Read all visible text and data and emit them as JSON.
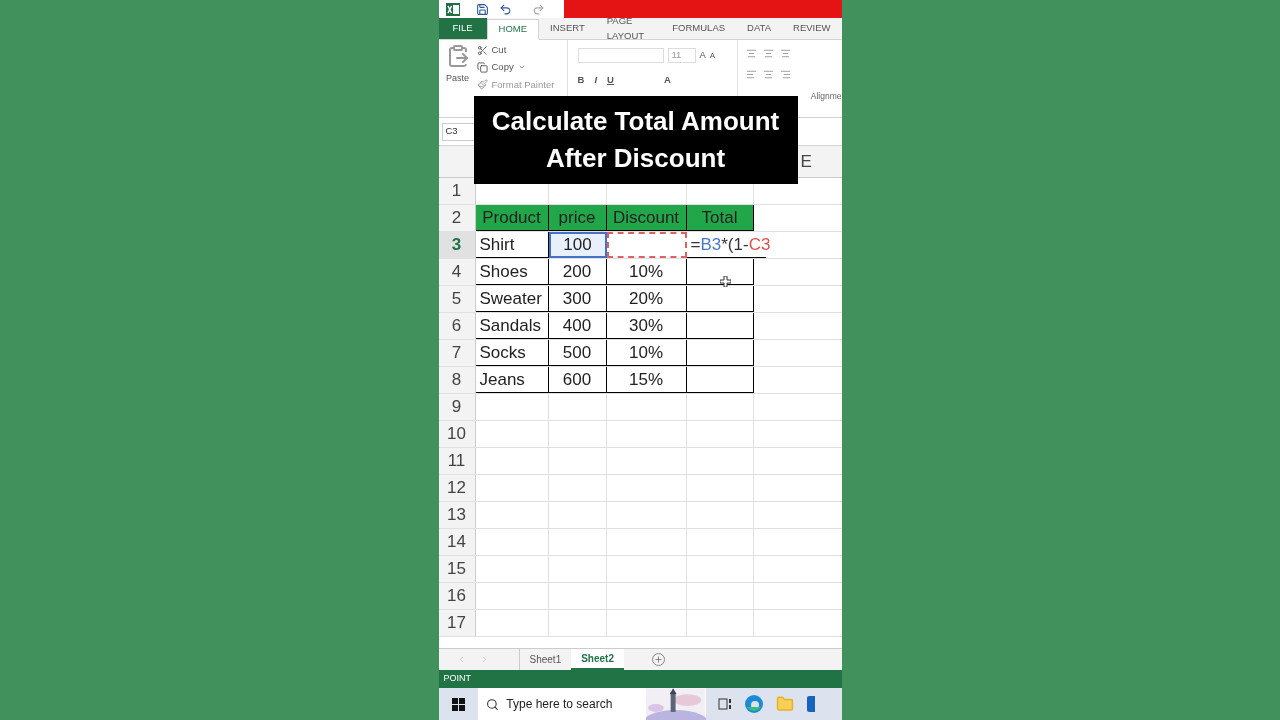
{
  "ribbon": {
    "tabs": [
      {
        "label": "FILE",
        "kind": "file",
        "selected": false
      },
      {
        "label": "HOME",
        "kind": "tab",
        "selected": true
      },
      {
        "label": "INSERT",
        "kind": "tab",
        "selected": false
      },
      {
        "label": "PAGE LAYOUT",
        "kind": "tab",
        "selected": false
      },
      {
        "label": "FORMULAS",
        "kind": "tab",
        "selected": false
      },
      {
        "label": "DATA",
        "kind": "tab",
        "selected": false
      },
      {
        "label": "REVIEW",
        "kind": "tab",
        "selected": false
      }
    ],
    "clipboard": {
      "paste": "Paste",
      "cut": "Cut",
      "copy": "Copy",
      "format_painter": "Format Painter"
    },
    "font": {
      "size": "11",
      "bold": "B",
      "italic": "I",
      "underline": "U",
      "grow": "A",
      "shrink": "A",
      "font_color": "A"
    },
    "group_label": "Alignme"
  },
  "name_box": "C3",
  "caption": [
    "Calculate Total Amount",
    "After Discount"
  ],
  "column_header": "E",
  "rows": [
    {
      "number": "1",
      "active": false
    },
    {
      "number": "2",
      "active": false,
      "cells": [
        {
          "text": "Product",
          "kind": "header"
        },
        {
          "text": "price",
          "kind": "header"
        },
        {
          "text": "Discount",
          "kind": "header"
        },
        {
          "text": "Total",
          "kind": "header"
        }
      ]
    },
    {
      "number": "3",
      "active": true,
      "cells": [
        {
          "text": "Shirt",
          "kind": "text"
        },
        {
          "text": "100",
          "kind": "number",
          "color": "#4472c4"
        },
        {
          "kind": "empty",
          "color": "#e06060"
        },
        {
          "kind": "formula",
          "formula_parts": [
            {
              "text": "=",
              "color": "#333333"
            },
            {
              "text": "B3",
              "color": "#4a78c8"
            },
            {
              "text": "*(1-",
              "color": "#333333"
            },
            {
              "text": "C3",
              "color": "#d9534f"
            }
          ]
        }
      ]
    },
    {
      "number": "4",
      "active": false,
      "cells": [
        {
          "text": "Shoes",
          "kind": "text"
        },
        {
          "text": "200",
          "kind": "number"
        },
        {
          "text": "10%",
          "kind": "number"
        },
        {
          "kind": "empty"
        }
      ]
    },
    {
      "number": "5",
      "active": false,
      "cells": [
        {
          "text": "Sweater",
          "kind": "text"
        },
        {
          "text": "300",
          "kind": "number"
        },
        {
          "text": "20%",
          "kind": "number"
        },
        {
          "kind": "empty"
        }
      ]
    },
    {
      "number": "6",
      "active": false,
      "cells": [
        {
          "text": "Sandals",
          "kind": "text"
        },
        {
          "text": "400",
          "kind": "number"
        },
        {
          "text": "30%",
          "kind": "number"
        },
        {
          "kind": "empty"
        }
      ]
    },
    {
      "number": "7",
      "active": false,
      "cells": [
        {
          "text": "Socks",
          "kind": "text"
        },
        {
          "text": "500",
          "kind": "number"
        },
        {
          "text": "10%",
          "kind": "number"
        },
        {
          "kind": "empty"
        }
      ]
    },
    {
      "number": "8",
      "active": false,
      "cells": [
        {
          "text": "Jeans",
          "kind": "text"
        },
        {
          "text": "600",
          "kind": "number"
        },
        {
          "text": "15%",
          "kind": "number"
        },
        {
          "kind": "empty"
        }
      ]
    },
    {
      "number": "9",
      "active": false
    },
    {
      "number": "10",
      "active": false
    },
    {
      "number": "11",
      "active": false
    },
    {
      "number": "12",
      "active": false
    },
    {
      "number": "13",
      "active": false
    },
    {
      "number": "14",
      "active": false
    },
    {
      "number": "15",
      "active": false
    },
    {
      "number": "16",
      "active": false
    },
    {
      "number": "17",
      "active": false
    }
  ],
  "sheet_tabs": [
    {
      "label": "Sheet1",
      "selected": false
    },
    {
      "label": "Sheet2",
      "selected": true
    }
  ],
  "status_bar": "POINT",
  "taskbar": {
    "search": {
      "placeholder": "Type here to search"
    }
  }
}
